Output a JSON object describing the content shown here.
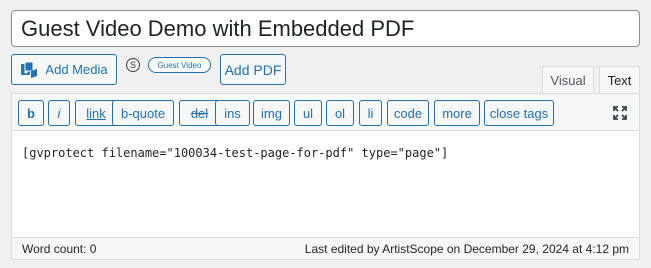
{
  "post": {
    "title": "Guest Video Demo with Embedded PDF"
  },
  "media_buttons": {
    "add_media": "Add Media",
    "gv_icon_glyph": "S",
    "guest_video": "Guest Video",
    "add_pdf": "Add PDF"
  },
  "editor_tabs": {
    "visual": "Visual",
    "text": "Text",
    "active": "Text"
  },
  "quicktags": {
    "b": "b",
    "i": "i",
    "link": "link",
    "bquote": "b-quote",
    "del": "del",
    "ins": "ins",
    "img": "img",
    "ul": "ul",
    "ol": "ol",
    "li": "li",
    "code": "code",
    "more": "more",
    "close_tags": "close tags"
  },
  "content": "[gvprotect filename=\"100034-test-page-for-pdf\" type=\"page\"]",
  "status": {
    "word_count": "Word count: 0",
    "last_edited": "Last edited by ArtistScope on December 29, 2024 at 4:12 pm"
  },
  "colors": {
    "accent": "#2271b1",
    "border": "#dcdcde",
    "background": "#f0f0f1"
  },
  "icons": {
    "add_media": "media-icon",
    "fullscreen": "fullscreen-expand-icon"
  }
}
